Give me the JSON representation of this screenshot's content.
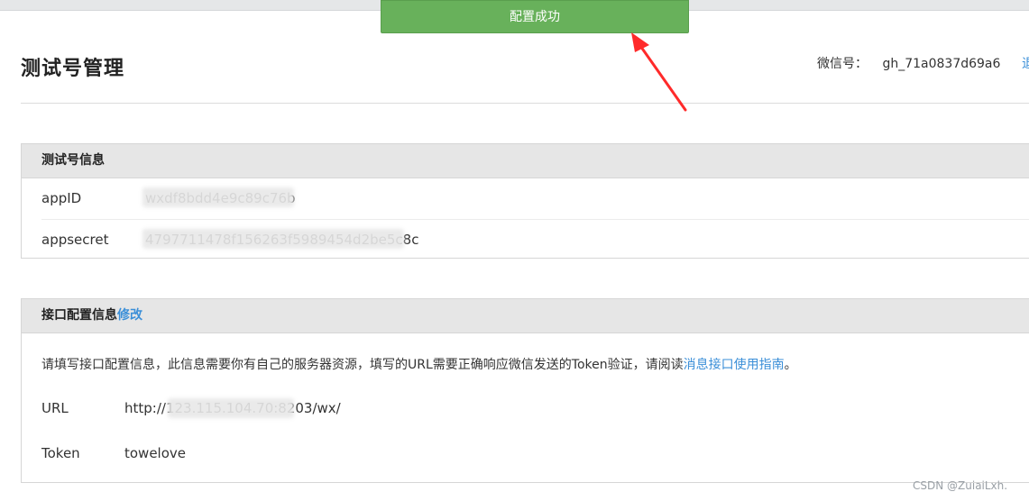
{
  "toast": {
    "message": "配置成功"
  },
  "header": {
    "title": "测试号管理",
    "wechat_label": "微信号：",
    "wechat_value": "gh_71a0837d69a6",
    "cut_link": "退"
  },
  "test_account_panel": {
    "title": "测试号信息",
    "rows": [
      {
        "label": "appID",
        "value": "wxdf8bdd4e9c89c76b"
      },
      {
        "label": "appsecret",
        "value": "4797711478f156263f5989454d2be5c8c"
      }
    ]
  },
  "interface_panel": {
    "title": "接口配置信息",
    "edit_link": "修改",
    "description_prefix": "请填写接口配置信息，此信息需要你有自己的服务器资源，填写的URL需要正确响应微信发送的Token验证，请阅读",
    "description_link": "消息接口使用指南",
    "description_suffix": "。",
    "url_label": "URL",
    "url_value": "http://123.115.104.70:8203/wx/",
    "token_label": "Token",
    "token_value": "towelove"
  },
  "watermark": "CSDN @ZuiaiLxh.",
  "colors": {
    "toast_green": "#68b15b",
    "link_blue": "#3b8fd8",
    "arrow_red": "#ff2a2a"
  }
}
